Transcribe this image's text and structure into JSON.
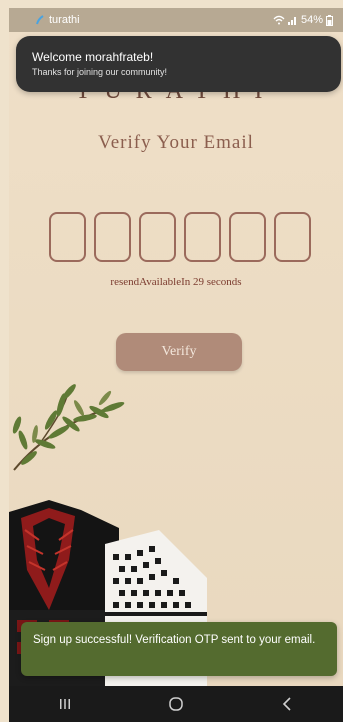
{
  "status_bar": {
    "app_name": "turathi",
    "battery": "54%"
  },
  "toast_top": {
    "title": "Welcome morahfrateb!",
    "subtitle": "Thanks for joining our community!"
  },
  "brand": "TURATHI",
  "page": {
    "title": "Verify Your Email",
    "otp_boxes": 6,
    "resend_text": "resendAvailableIn 29 seconds",
    "verify_label": "Verify"
  },
  "toast_bottom": {
    "message": "Sign up successful! Verification OTP sent to your email."
  },
  "nav": {
    "recent_icon": "recents-icon",
    "home_icon": "home-icon",
    "back_icon": "back-icon"
  },
  "colors": {
    "accent": "#9b6a5c",
    "button": "#b08b79",
    "success_toast": "#546b2f",
    "dark_toast": "#323232"
  }
}
